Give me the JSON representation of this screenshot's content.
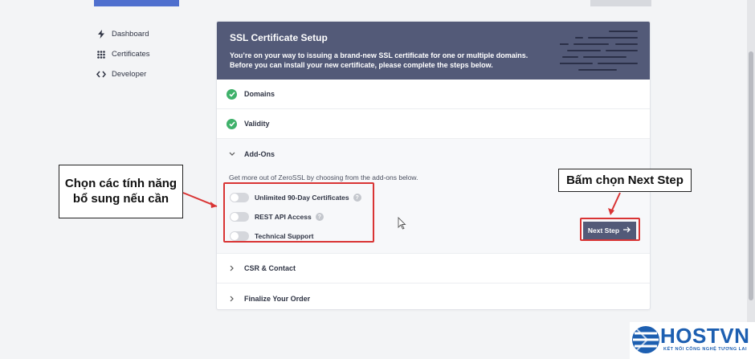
{
  "sidebar": {
    "items": [
      {
        "label": "Dashboard",
        "icon": "bolt-icon"
      },
      {
        "label": "Certificates",
        "icon": "grid-icon"
      },
      {
        "label": "Developer",
        "icon": "code-icon"
      }
    ]
  },
  "card": {
    "title": "SSL Certificate Setup",
    "subtitle_line1": "You’re on your way to issuing a brand-new SSL certificate for one or multiple domains.",
    "subtitle_line2": "Before you can install your new certificate, please complete the steps below."
  },
  "steps": {
    "domains": "Domains",
    "validity": "Validity",
    "addons": "Add-Ons",
    "csr": "CSR & Contact",
    "finalize": "Finalize Your Order"
  },
  "addons": {
    "description": "Get more out of ZeroSSL by choosing from the add-ons below.",
    "options": [
      {
        "label": "Unlimited 90-Day Certificates",
        "enabled": false,
        "help": true
      },
      {
        "label": "REST API Access",
        "enabled": false,
        "help": true
      },
      {
        "label": "Technical Support",
        "enabled": false,
        "help": false
      }
    ],
    "next_label": "Next Step"
  },
  "annotations": {
    "left_line1": "Chọn các tính năng",
    "left_line2": "bổ sung nếu cần",
    "right": "Bấm chọn Next Step"
  },
  "logo": {
    "name": "HOSTVN",
    "tagline": "KẾT NỐI CÔNG NGHỆ TƯƠNG LAI"
  },
  "colors": {
    "header": "#535a78",
    "success": "#3fb16a",
    "highlight": "#d93434",
    "brand": "#1d5fb1"
  }
}
